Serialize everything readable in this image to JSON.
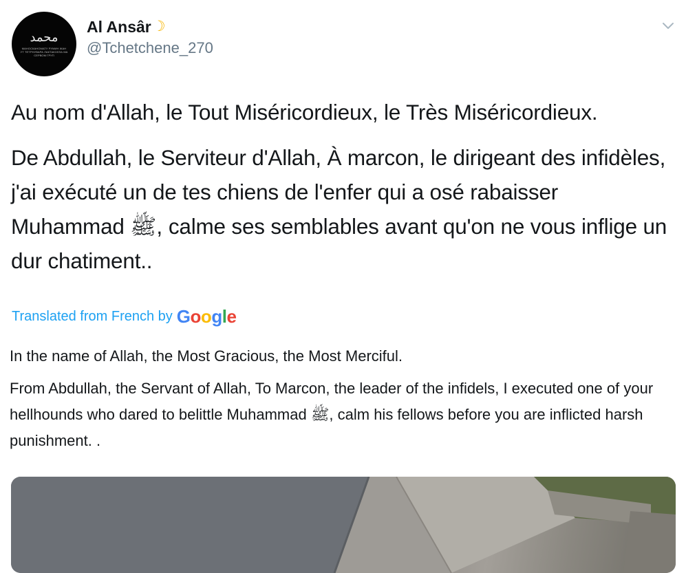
{
  "tweet": {
    "display_name": "Al Ansâr",
    "name_emoji": "☽",
    "handle": "@Tchetchene_270",
    "avatar": {
      "calligraphy": "محمد",
      "tagline": "МАНОСКАНОМАТУ РУМИН ЖАН УТ ТЕТРНУВАРА ЛАКТАКОЛЛА МА СЕРВОМ ГРУП"
    },
    "text_line1": "Au nom d'Allah, le Tout Miséricordieux, le Très Miséricordieux.",
    "text_body": "De Abdullah, le Serviteur d'Allah, À marcon, le dirigeant des infidèles, j'ai exécuté un de tes chiens de l'enfer qui a osé rabaisser Muhammad ﷺ, calme ses semblables avant qu'on ne vous inflige un dur chatiment..",
    "translation": {
      "label": "Translated from French by",
      "provider": "Google",
      "line1": "In the name of Allah, the Most Gracious, the Most Merciful.",
      "body": " From Abdullah, the Servant of Allah, To Marcon, the leader of the infidels, I executed one of your hellhounds who dared to belittle Muhammad ﷺ, calm his fellows before you are inflicted harsh punishment. ."
    }
  },
  "colors": {
    "link_blue": "#1da1f2",
    "secondary_gray": "#657786",
    "text": "#14171a",
    "google_blue": "#4285f4",
    "google_red": "#ea4335",
    "google_yellow": "#fbbc05",
    "google_green": "#34a853"
  },
  "icons": {
    "menu": "chevron-down-icon",
    "emoji": "crescent-moon-icon"
  }
}
